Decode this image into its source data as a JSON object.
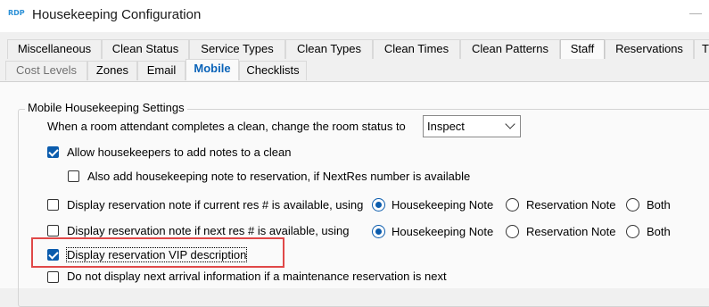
{
  "window": {
    "logo_text": "RDP",
    "title": "Housekeeping Configuration"
  },
  "tabs_row1": [
    {
      "label": "Miscellaneous"
    },
    {
      "label": "Clean Status"
    },
    {
      "label": "Service Types"
    },
    {
      "label": "Clean Types"
    },
    {
      "label": "Clean Times"
    },
    {
      "label": "Clean Patterns"
    },
    {
      "label": "Staff"
    },
    {
      "label": "Reservations"
    },
    {
      "label": "T"
    }
  ],
  "tabs_row2": [
    {
      "label": "Cost Levels"
    },
    {
      "label": "Zones"
    },
    {
      "label": "Email"
    },
    {
      "label": "Mobile"
    },
    {
      "label": "Checklists"
    }
  ],
  "mobile_settings": {
    "group_title": "Mobile Housekeeping Settings",
    "status_label": "When a room attendant completes a clean, change the room status to",
    "status_value": "Inspect",
    "allow_notes": {
      "label": "Allow housekeepers to add notes to a clean",
      "checked": true
    },
    "add_note_reservation": {
      "label": "Also add housekeeping note to reservation, if NextRes number is available",
      "checked": false
    },
    "current_res_note": {
      "label": "Display reservation note if current res # is available, using",
      "checked": false,
      "options": [
        "Housekeeping Note",
        "Reservation Note",
        "Both"
      ],
      "selected": "Housekeeping Note"
    },
    "next_res_note": {
      "label": "Display reservation note if next res # is available, using",
      "checked": false,
      "options": [
        "Housekeeping Note",
        "Reservation Note",
        "Both"
      ],
      "selected": "Housekeeping Note"
    },
    "vip_description": {
      "label": "Display reservation VIP description",
      "checked": true
    },
    "no_next_arrival": {
      "label": "Do not display next arrival information if a maintenance reservation is next",
      "checked": false
    }
  },
  "colors": {
    "accent": "#0b5cad",
    "highlight": "#e04848"
  }
}
